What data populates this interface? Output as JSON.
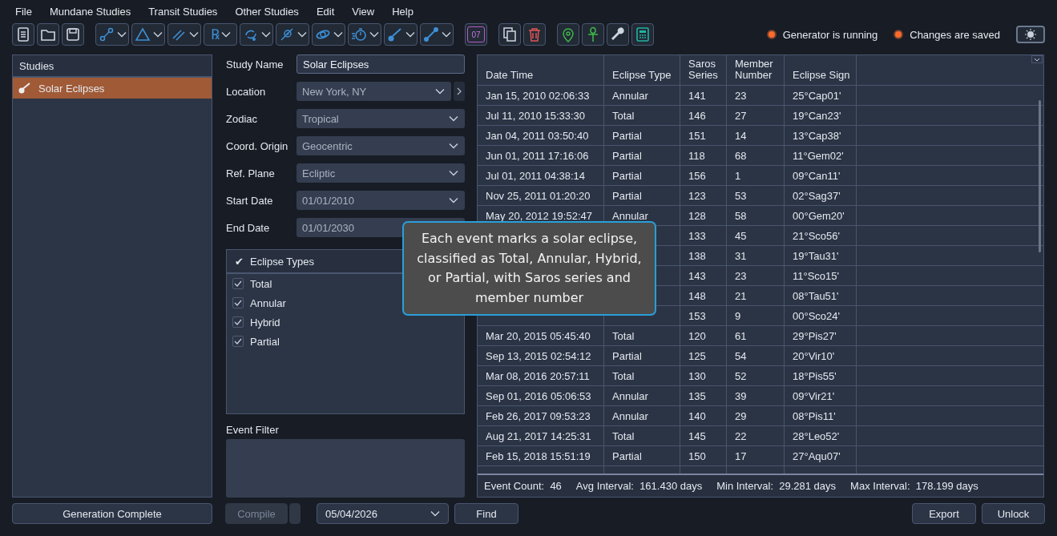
{
  "menu": [
    "File",
    "Mundane Studies",
    "Transit Studies",
    "Other Studies",
    "Edit",
    "View",
    "Help"
  ],
  "toolbar": {
    "glyph": "℞",
    "calendar_day": "07"
  },
  "status": [
    {
      "label": "Generator is running",
      "on": true
    },
    {
      "label": "Changes are saved",
      "on": true
    }
  ],
  "studies": {
    "title": "Studies",
    "items": [
      {
        "label": "Solar Eclipses",
        "selected": true
      }
    ]
  },
  "form": {
    "study_name": {
      "label": "Study Name",
      "value": "Solar Eclipses"
    },
    "selects": [
      {
        "label": "Location",
        "value": "New York, NY"
      },
      {
        "label": "Zodiac",
        "value": "Tropical"
      },
      {
        "label": "Coord. Origin",
        "value": "Geocentric"
      },
      {
        "label": "Ref. Plane",
        "value": "Ecliptic"
      },
      {
        "label": "Start Date",
        "value": "01/01/2010"
      },
      {
        "label": "End Date",
        "value": "01/01/2030"
      }
    ],
    "types": {
      "title": "Eclipse Types",
      "tick": "✔",
      "items": [
        {
          "label": "Total",
          "checked": true
        },
        {
          "label": "Annular",
          "checked": true
        },
        {
          "label": "Hybrid",
          "checked": true
        },
        {
          "label": "Partial",
          "checked": true
        }
      ]
    },
    "event_filter": "Event Filter"
  },
  "table": {
    "columns": [
      "Date Time",
      "Eclipse Type",
      "Saros Series",
      "Member Number",
      "Eclipse Sign"
    ],
    "rows": [
      {
        "date": "Jan 15, 2010 02:06:33",
        "type": "Annular",
        "saros": "141",
        "member": "23",
        "sign": "25°Cap01'"
      },
      {
        "date": "Jul 11, 2010 15:33:30",
        "type": "Total",
        "saros": "146",
        "member": "27",
        "sign": "19°Can23'"
      },
      {
        "date": "Jan 04, 2011 03:50:40",
        "type": "Partial",
        "saros": "151",
        "member": "14",
        "sign": "13°Cap38'"
      },
      {
        "date": "Jun 01, 2011 17:16:06",
        "type": "Partial",
        "saros": "118",
        "member": "68",
        "sign": "11°Gem02'"
      },
      {
        "date": "Jul 01, 2011 04:38:14",
        "type": "Partial",
        "saros": "156",
        "member": "1",
        "sign": "09°Can11'"
      },
      {
        "date": "Nov 25, 2011 01:20:20",
        "type": "Partial",
        "saros": "123",
        "member": "53",
        "sign": "02°Sag37'"
      },
      {
        "date": "May 20, 2012 19:52:47",
        "type": "Annular",
        "saros": "128",
        "member": "58",
        "sign": "00°Gem20'"
      },
      {
        "saros": "133",
        "member": "45",
        "sign": "21°Sco56'"
      },
      {
        "saros": "138",
        "member": "31",
        "sign": "19°Tau31'"
      },
      {
        "saros": "143",
        "member": "23",
        "sign": "11°Sco15'"
      },
      {
        "saros": "148",
        "member": "21",
        "sign": "08°Tau51'"
      },
      {
        "saros": "153",
        "member": "9",
        "sign": "00°Sco24'"
      },
      {
        "date": "Mar 20, 2015 05:45:40",
        "type": "Total",
        "saros": "120",
        "member": "61",
        "sign": "29°Pis27'"
      },
      {
        "date": "Sep 13, 2015 02:54:12",
        "type": "Partial",
        "saros": "125",
        "member": "54",
        "sign": "20°Vir10'"
      },
      {
        "date": "Mar 08, 2016 20:57:11",
        "type": "Total",
        "saros": "130",
        "member": "52",
        "sign": "18°Pis55'"
      },
      {
        "date": "Sep 01, 2016 05:06:53",
        "type": "Annular",
        "saros": "135",
        "member": "39",
        "sign": "09°Vir21'"
      },
      {
        "date": "Feb 26, 2017 09:53:23",
        "type": "Annular",
        "saros": "140",
        "member": "29",
        "sign": "08°Pis11'"
      },
      {
        "date": "Aug 21, 2017 14:25:31",
        "type": "Total",
        "saros": "145",
        "member": "22",
        "sign": "28°Leo52'"
      },
      {
        "date": "Feb 15, 2018 15:51:19",
        "type": "Partial",
        "saros": "150",
        "member": "17",
        "sign": "27°Aqu07'"
      }
    ],
    "summary": [
      {
        "label": "Event Count:",
        "value": "46"
      },
      {
        "label": "Avg Interval:",
        "value": "161.430 days"
      },
      {
        "label": "Min Interval:",
        "value": "29.281 days"
      },
      {
        "label": "Max Interval:",
        "value": "178.199 days"
      }
    ]
  },
  "bottom": {
    "generation": "Generation Complete",
    "compile": {
      "label": "Compile",
      "disabled": true
    },
    "find_date": "05/04/2026",
    "find": "Find",
    "export": "Export",
    "unlock": "Unlock"
  },
  "tooltip": "Each event marks a solar eclipse, classified as Total, Annular, Hybrid, or Partial, with Saros series and member number"
}
